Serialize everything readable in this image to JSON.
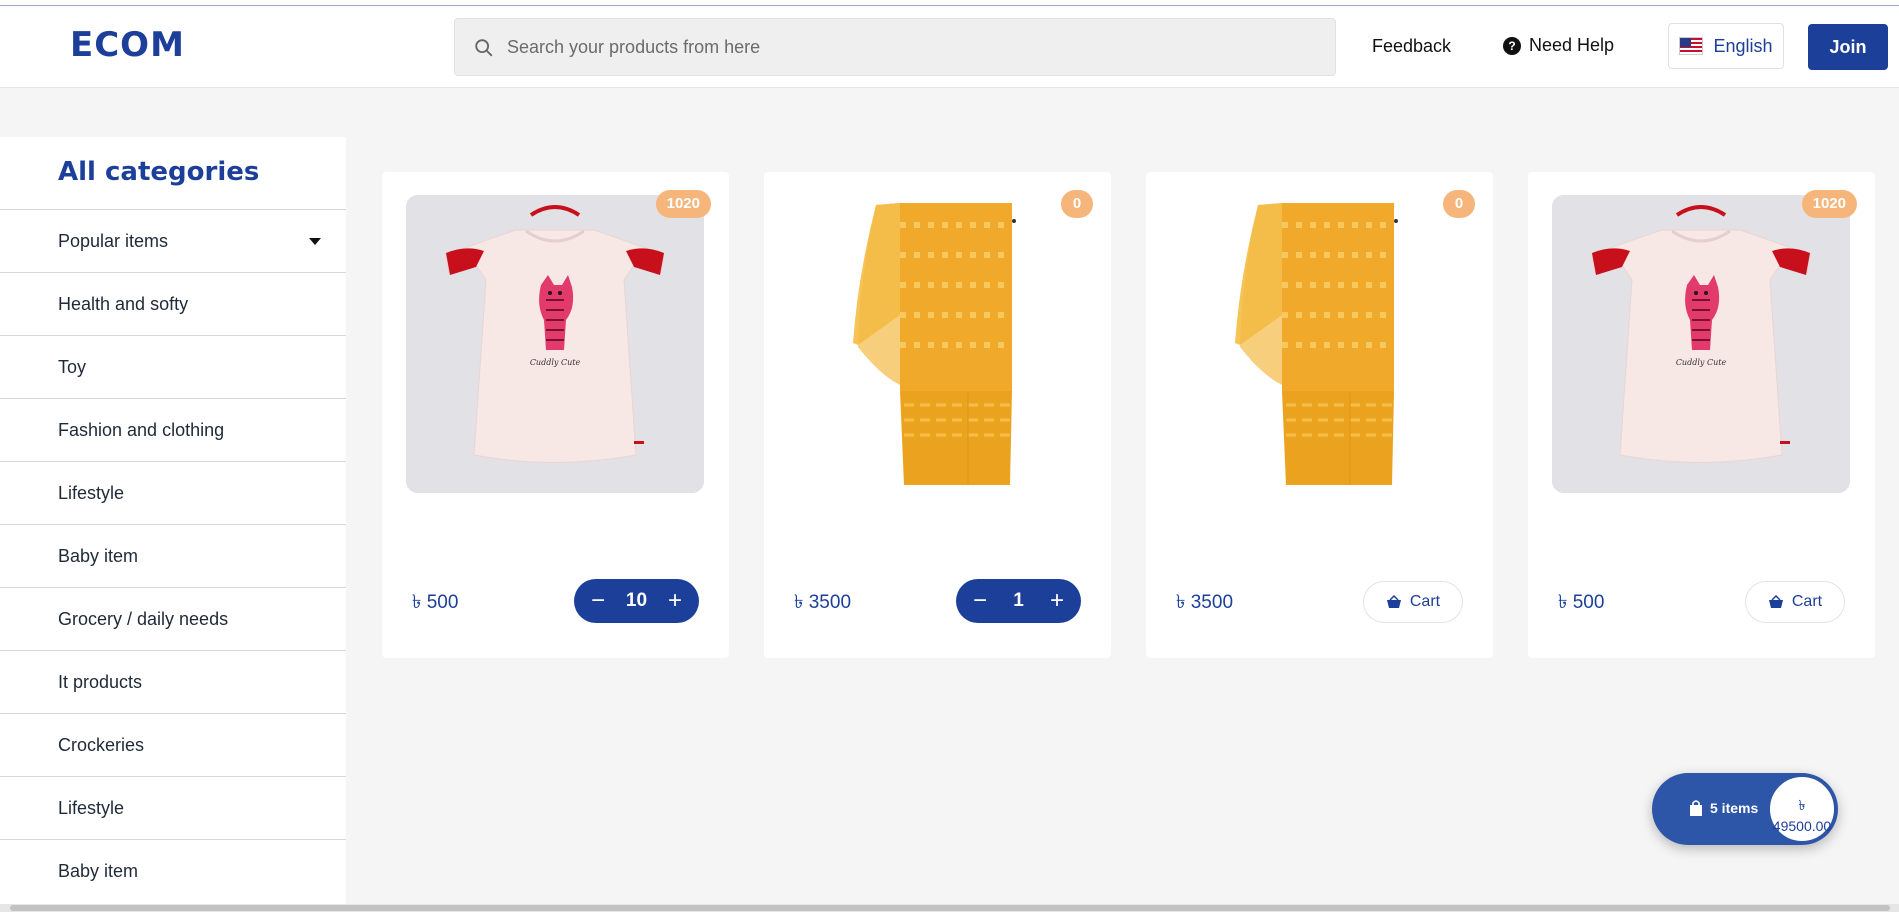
{
  "header": {
    "logo": "ECOM",
    "search_placeholder": "Search your products from here",
    "feedback_label": "Feedback",
    "help_label": "Need Help",
    "language_label": "English",
    "join_label": "Join"
  },
  "sidebar": {
    "title": "All categories",
    "items": [
      {
        "label": "Popular items"
      },
      {
        "label": "Health and softy"
      },
      {
        "label": "Toy"
      },
      {
        "label": "Fashion and clothing"
      },
      {
        "label": "Lifestyle"
      },
      {
        "label": "Baby item"
      },
      {
        "label": "Grocery / daily needs"
      },
      {
        "label": "It products"
      },
      {
        "label": "Crockeries"
      },
      {
        "label": "Lifestyle"
      },
      {
        "label": "Baby item"
      }
    ]
  },
  "products": [
    {
      "badge": "1020",
      "price": "৳ 500",
      "quantity": "10",
      "image": "tshirt"
    },
    {
      "badge": "0",
      "price": "৳ 3500",
      "quantity": "1",
      "image": "saree"
    },
    {
      "badge": "0",
      "price": "৳ 3500",
      "cart_label": "Cart",
      "image": "saree"
    },
    {
      "badge": "1020",
      "price": "৳ 500",
      "cart_label": "Cart",
      "image": "tshirt"
    }
  ],
  "floating_cart": {
    "items_label": "5 items",
    "currency": "৳",
    "total": "49500.00"
  },
  "colors": {
    "primary": "#1c3f99",
    "badge": "#f6b57b",
    "page_bg": "#f5f5f5"
  }
}
